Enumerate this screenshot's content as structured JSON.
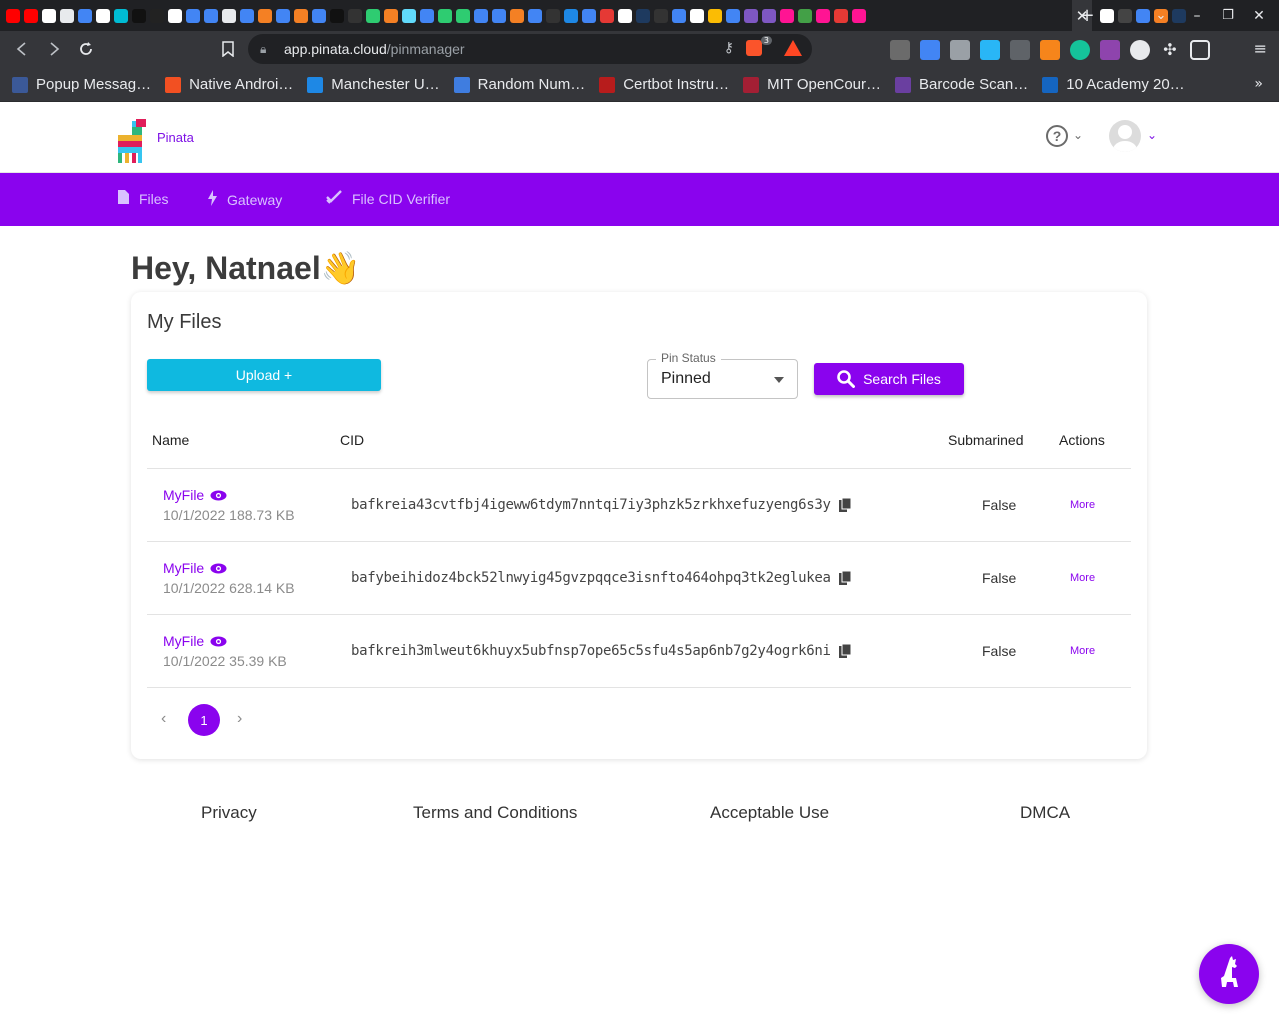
{
  "browser": {
    "new_tab_label": "+",
    "active_tab_close": "✕",
    "url_host": "app.pinata.cloud",
    "url_path": "/pinmanager",
    "brave_badge": "3",
    "bookmarks": [
      {
        "label": "Popup Messag…",
        "color": "#3b5998"
      },
      {
        "label": "Native Androi…",
        "color": "#f25022"
      },
      {
        "label": "Manchester U…",
        "color": "#1e88e5"
      },
      {
        "label": "Random Num…",
        "color": "#3f7de0"
      },
      {
        "label": "Certbot Instru…",
        "color": "#b71c1c"
      },
      {
        "label": "MIT OpenCour…",
        "color": "#a31f34"
      },
      {
        "label": "Barcode Scan…",
        "color": "#6a3fa0"
      },
      {
        "label": "10 Academy 20…",
        "color": "#1565c0"
      }
    ]
  },
  "app": {
    "brand": "Pinata",
    "accent": "#8a03ee",
    "nav": [
      {
        "label": "Files",
        "icon": "file-icon"
      },
      {
        "label": "Gateway",
        "icon": "bolt-icon"
      },
      {
        "label": "File CID Verifier",
        "icon": "check-icon"
      }
    ],
    "greeting": "Hey, Natnael",
    "greeting_emoji": "👋"
  },
  "files": {
    "title": "My Files",
    "upload_label": "Upload +",
    "pin_status_label": "Pin Status",
    "pin_status_value": "Pinned",
    "search_label": "Search Files",
    "columns": [
      "Name",
      "CID",
      "Submarined",
      "Actions"
    ],
    "rows": [
      {
        "name": "MyFile",
        "meta": "10/1/2022 188.73 KB",
        "cid": "bafkreia43cvtfbj4igeww6tdym7nntqi7iy3phzk5zrkhxefuzyeng6s3y",
        "submarined": "False",
        "action": "More"
      },
      {
        "name": "MyFile",
        "meta": "10/1/2022 628.14 KB",
        "cid": "bafybeihidoz4bck52lnwyig45gvzpqqce3isnfto464ohpq3tk2eglukea",
        "submarined": "False",
        "action": "More"
      },
      {
        "name": "MyFile",
        "meta": "10/1/2022 35.39 KB",
        "cid": "bafkreih3mlweut6khuyx5ubfnsp7ope65c5sfu4s5ap6nb7g2y4ogrk6ni",
        "submarined": "False",
        "action": "More"
      }
    ],
    "pager": {
      "prev": "‹",
      "current": "1",
      "next": "›"
    }
  },
  "footer": {
    "links": [
      "Privacy",
      "Terms and Conditions",
      "Acceptable Use",
      "DMCA"
    ]
  }
}
